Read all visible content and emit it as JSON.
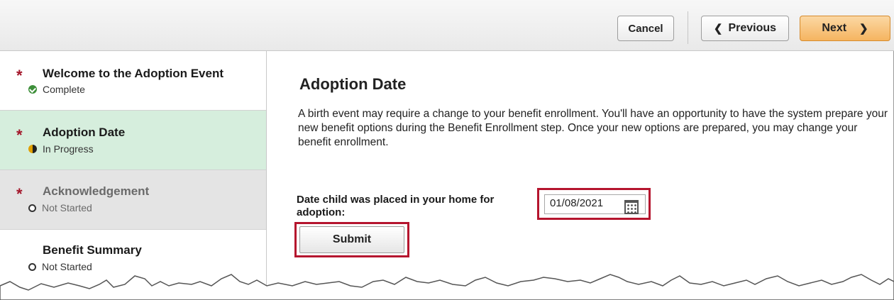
{
  "toolbar": {
    "cancel_label": "Cancel",
    "previous_label": "Previous",
    "next_label": "Next"
  },
  "sidebar": {
    "items": [
      {
        "label": "Welcome to the Adoption Event",
        "status": "Complete",
        "required": true
      },
      {
        "label": "Adoption Date",
        "status": "In Progress",
        "required": true
      },
      {
        "label": "Acknowledgement",
        "status": "Not Started",
        "required": true
      },
      {
        "label": "Benefit Summary",
        "status": "Not Started",
        "required": false
      }
    ],
    "required_marker": "*"
  },
  "main": {
    "title": "Adoption Date",
    "description": "A birth event may require a change to your benefit enrollment. You'll have an opportunity to have the system prepare your new benefit options during the Benefit Enrollment step. Once your new options are prepared, you may change your benefit enrollment.",
    "date_field": {
      "label": "Date child was placed in your home for adoption:",
      "value": "01/08/2021"
    },
    "submit_label": "Submit"
  },
  "colors": {
    "accent_orange": "#f5b460",
    "selected_green": "#d6eedd",
    "highlight_red": "#b5152e",
    "required_red": "#a3162a"
  },
  "icons": [
    "chevron-left-icon",
    "chevron-right-icon",
    "complete-check-icon",
    "in-progress-icon",
    "not-started-icon",
    "calendar-icon"
  ]
}
